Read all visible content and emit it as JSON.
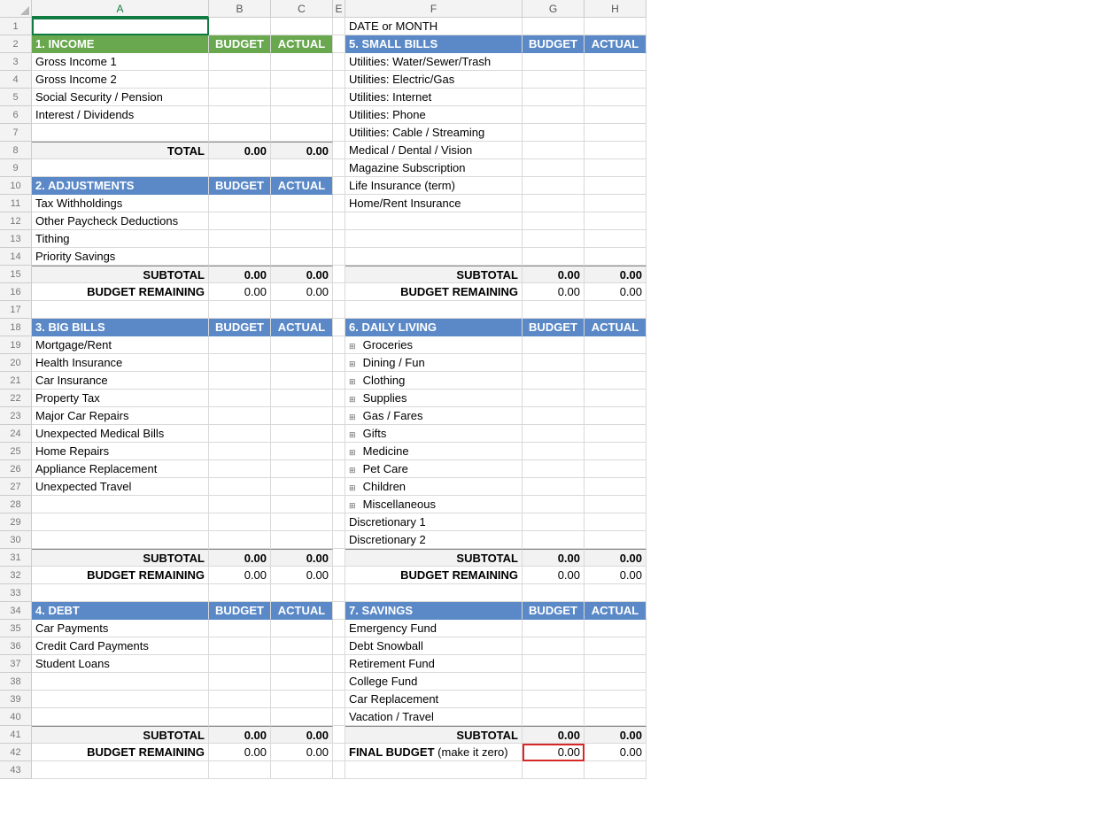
{
  "columns": [
    "A",
    "B",
    "C",
    "E",
    "F",
    "G",
    "H"
  ],
  "date_label": "DATE  or MONTH",
  "budget_label": "BUDGET",
  "actual_label": "ACTUAL",
  "subtotal_label": "SUBTOTAL",
  "total_label": "TOTAL",
  "budget_remaining_label": "BUDGET REMAINING",
  "zero": "0.00",
  "sec1": {
    "title": "1. INCOME",
    "rows": [
      "Gross Income 1",
      "Gross Income 2",
      "Social Security / Pension",
      "Interest / Dividends",
      ""
    ]
  },
  "sec2": {
    "title": "2. ADJUSTMENTS",
    "rows": [
      "Tax Withholdings",
      "Other Paycheck Deductions",
      "Tithing",
      "Priority Savings"
    ]
  },
  "sec3": {
    "title": "3. BIG BILLS",
    "rows": [
      "Mortgage/Rent",
      "Health Insurance",
      "Car Insurance",
      "Property Tax",
      "Major Car Repairs",
      "Unexpected Medical Bills",
      "Home Repairs",
      "Appliance Replacement",
      "Unexpected Travel",
      "",
      "",
      ""
    ]
  },
  "sec4": {
    "title": "4. DEBT",
    "rows": [
      "Car Payments",
      "Credit Card Payments",
      "Student Loans",
      "",
      "",
      ""
    ]
  },
  "sec5": {
    "title": "5. SMALL BILLS",
    "rows": [
      "Utilities: Water/Sewer/Trash",
      "Utilities: Electric/Gas",
      "Utilities: Internet",
      "Utilities: Phone",
      "Utilities: Cable / Streaming",
      "Medical / Dental / Vision",
      "Magazine Subscription",
      "Life Insurance (term)",
      "Home/Rent Insurance",
      "",
      "",
      ""
    ]
  },
  "sec6": {
    "title": "6. DAILY LIVING",
    "rows": [
      "Groceries",
      "Dining / Fun",
      "Clothing",
      "Supplies",
      "Gas / Fares",
      "Gifts",
      "Medicine",
      "Pet Care",
      "Children",
      "Miscellaneous",
      "Discretionary 1",
      "Discretionary 2"
    ],
    "icon_rows": 10
  },
  "sec7": {
    "title": "7. SAVINGS",
    "rows": [
      "Emergency Fund",
      "Debt Snowball",
      "Retirement Fund",
      "College Fund",
      "Car Replacement",
      "Vacation / Travel"
    ]
  },
  "final_budget_label_bold": "FINAL BUDGET",
  "final_budget_label_rest": " (make it zero)"
}
